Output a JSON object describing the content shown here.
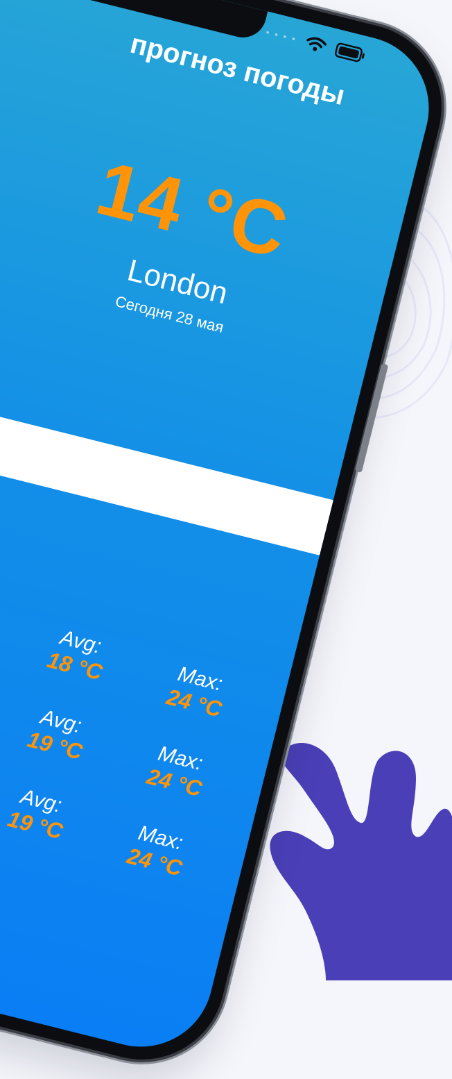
{
  "app": {
    "title": "прогноз погоды"
  },
  "weather": {
    "temperature": "14 °C",
    "city": "London",
    "date": "Сегодня 28 мая"
  },
  "search": {
    "value": "",
    "placeholder": ""
  },
  "forecast": [
    {
      "avg_label": "Avg:",
      "avg_value": "18 °C",
      "max_label": "Max:",
      "max_value": "24 °C"
    },
    {
      "avg_label": "Avg:",
      "avg_value": "19 °C",
      "max_label": "Max:",
      "max_value": "24 °C"
    },
    {
      "avg_label": "Avg:",
      "avg_value": "19 °C",
      "max_label": "Max:",
      "max_value": "24 °C"
    }
  ],
  "colors": {
    "accent": "#ff9408",
    "gradient_top": "#27a6d6",
    "gradient_bottom": "#0a7ef5",
    "blob": "#4a3fb6",
    "page_background": "#f5f6fb"
  },
  "icons": {
    "wifi": "wifi-icon",
    "battery": "battery-icon",
    "signal": "signal-dots-icon"
  }
}
